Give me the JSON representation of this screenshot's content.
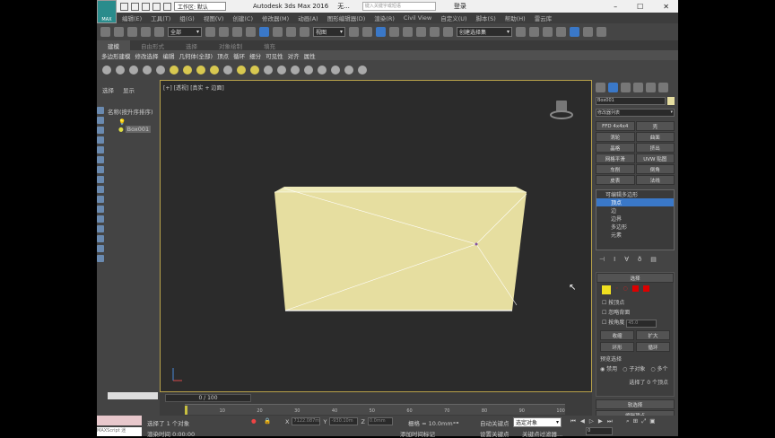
{
  "app": {
    "logo": "MAX",
    "title": "Autodesk 3ds Max 2016",
    "doc": "无...",
    "workspace": "工作区: 默认",
    "search_placeholder": "键入关键字或短语",
    "user": "登录"
  },
  "menu": [
    "编辑(E)",
    "工具(T)",
    "组(G)",
    "视图(V)",
    "创建(C)",
    "修改器(M)",
    "动画(A)",
    "图形编辑器(D)",
    "渲染(R)",
    "Civil View",
    "自定义(U)",
    "脚本(S)",
    "帮助(H)",
    "雷云库"
  ],
  "toolbar": {
    "filter": "全部",
    "ref_coord": "视图",
    "named_sel": "创建选择集"
  },
  "ribbon": {
    "tabs": [
      "建模",
      "自由形式",
      "选择",
      "对象绘制",
      "填充"
    ],
    "active": 0,
    "row": [
      "多边形建模",
      "修改选择",
      "编辑",
      "几何体(全部)",
      "顶点",
      "循环",
      "细分",
      "可见性",
      "对齐",
      "属性"
    ]
  },
  "explorer": {
    "tabs": [
      "选择",
      "显示"
    ],
    "column": "名称(按升序排序)",
    "items": [
      "Box001"
    ]
  },
  "viewport": {
    "label": "[+] [透视] [真实 + 边面]"
  },
  "command": {
    "object_name": "Box001",
    "modifier_list": "修改器列表",
    "buttons": [
      "FFD 4x4x4",
      "壳",
      "涡轮",
      "曲面",
      "晶格",
      "挤出",
      "网格平滑",
      "UVW 贴图",
      "车削",
      "倒角",
      "皮表",
      "法线"
    ],
    "stack": {
      "root": "可编辑多边形",
      "items": [
        "顶点",
        "边",
        "边界",
        "多边形",
        "元素"
      ],
      "selected": 0
    },
    "rollout": {
      "title": "选择",
      "by_vertex": "按顶点",
      "ignore_backfacing": "忽略背面",
      "by_angle": "按角度",
      "angle_value": "45.0",
      "shrink": "收缩",
      "grow": "扩大",
      "ring": "环形",
      "loop": "循环",
      "preview": "预览选择",
      "preview_opts": [
        "禁用",
        "子对象",
        "多个"
      ],
      "preview_selected": 0,
      "status": "选择了 0 个顶点"
    },
    "soft_selection": "软选择",
    "edit_vertices": "编辑顶点"
  },
  "timeline": {
    "frame": "0 / 100",
    "ticks": [
      "0",
      "10",
      "20",
      "30",
      "40",
      "50",
      "60",
      "70",
      "80",
      "90",
      "100"
    ],
    "progress": 0
  },
  "status": {
    "maxscript": "MAXScript 迷",
    "selected": "选择了 1 个对象",
    "render_time": "渲染时间 0:00:00",
    "x": "7122.087m",
    "y": "-930.10m",
    "z": "0.0mm",
    "grid": "栅格 = 10.0mm",
    "autokey": "自动关键点",
    "setkey": "设置关键点",
    "key_mode": "选定对象",
    "add_time_tag": "添加时间标记",
    "key_filters": "关键点过滤器...",
    "frame": "0"
  },
  "colors": {
    "accent": "#3a78c8",
    "box": "#e6dea0",
    "viewport_border": "#b8a24a"
  }
}
